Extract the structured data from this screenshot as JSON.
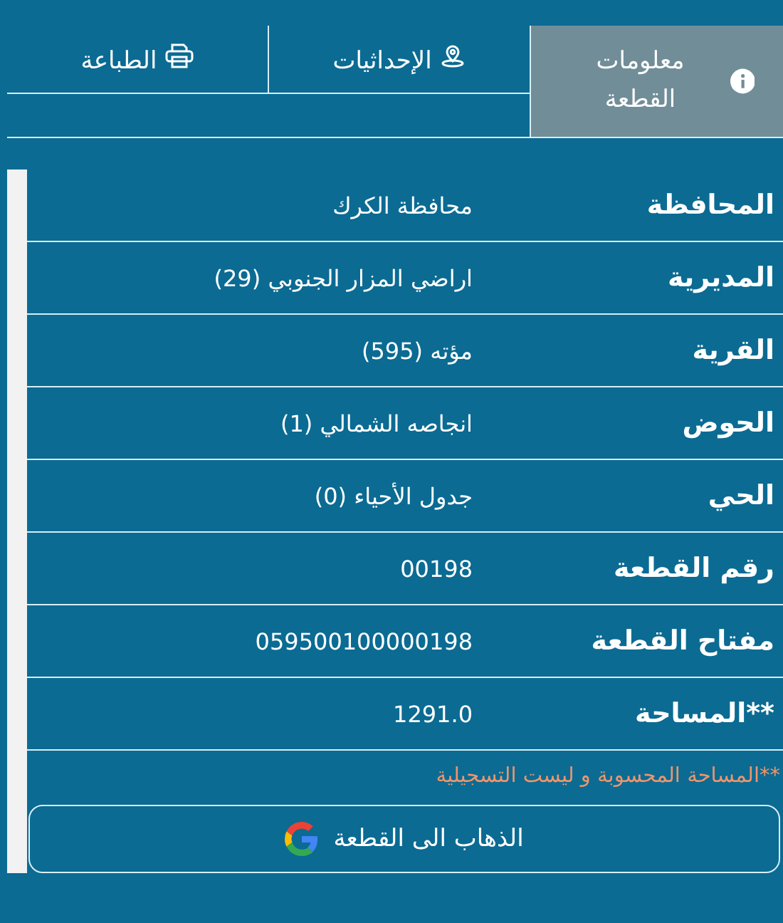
{
  "tabs": [
    {
      "label": "معلومات القطعة",
      "kind": "info",
      "selected": true
    },
    {
      "label": "الإحداثيات",
      "kind": "location",
      "selected": false
    },
    {
      "label": "الطباعة",
      "kind": "print",
      "selected": false
    }
  ],
  "details": [
    {
      "label": "المحافظة",
      "value": "محافظة الكرك"
    },
    {
      "label": "المديرية",
      "value": "اراضي المزار الجنوبي (29)"
    },
    {
      "label": "القرية",
      "value": "مؤته (595)"
    },
    {
      "label": "الحوض",
      "value": "انجاصه الشمالي (1)"
    },
    {
      "label": "الحي",
      "value": "جدول الأحياء (0)"
    },
    {
      "label": "رقم القطعة",
      "value": "00198"
    },
    {
      "label": "مفتاح القطعة",
      "value": "059500100000198"
    },
    {
      "label": "**المساحة",
      "value": "1291.0"
    }
  ],
  "footnote": "**المساحة المحسوبة و ليست التسجيلية",
  "map_button": {
    "label": "الذهاب الى القطعة"
  }
}
